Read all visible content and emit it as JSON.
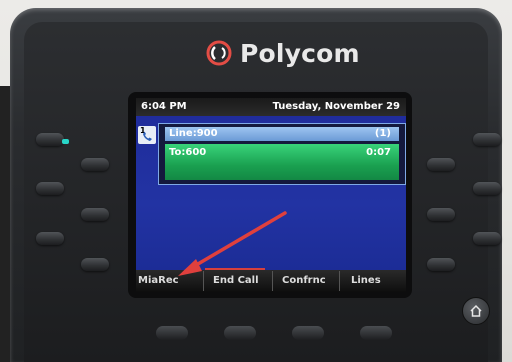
{
  "brand": {
    "name": "Polycom",
    "logo_icon": "polycom-logo-icon"
  },
  "screen": {
    "time": "6:04 PM",
    "date": "Tuesday, November 29",
    "line_icon": "phone-line-icon",
    "line_icon_number": "1",
    "line": {
      "label": "Line:900",
      "count": "(1)"
    },
    "call": {
      "to": "To:600",
      "duration": "0:07"
    }
  },
  "softkeys": [
    "MiaRec",
    "End Call",
    "Confrnc",
    "Lines"
  ],
  "colors": {
    "screen_bg": "#2233a3",
    "call_green": "#1aa050",
    "annotation_arrow": "#e0403d",
    "led": "#28d6c8"
  },
  "annotation": {
    "type": "arrow",
    "points_to": "MiaRec"
  }
}
